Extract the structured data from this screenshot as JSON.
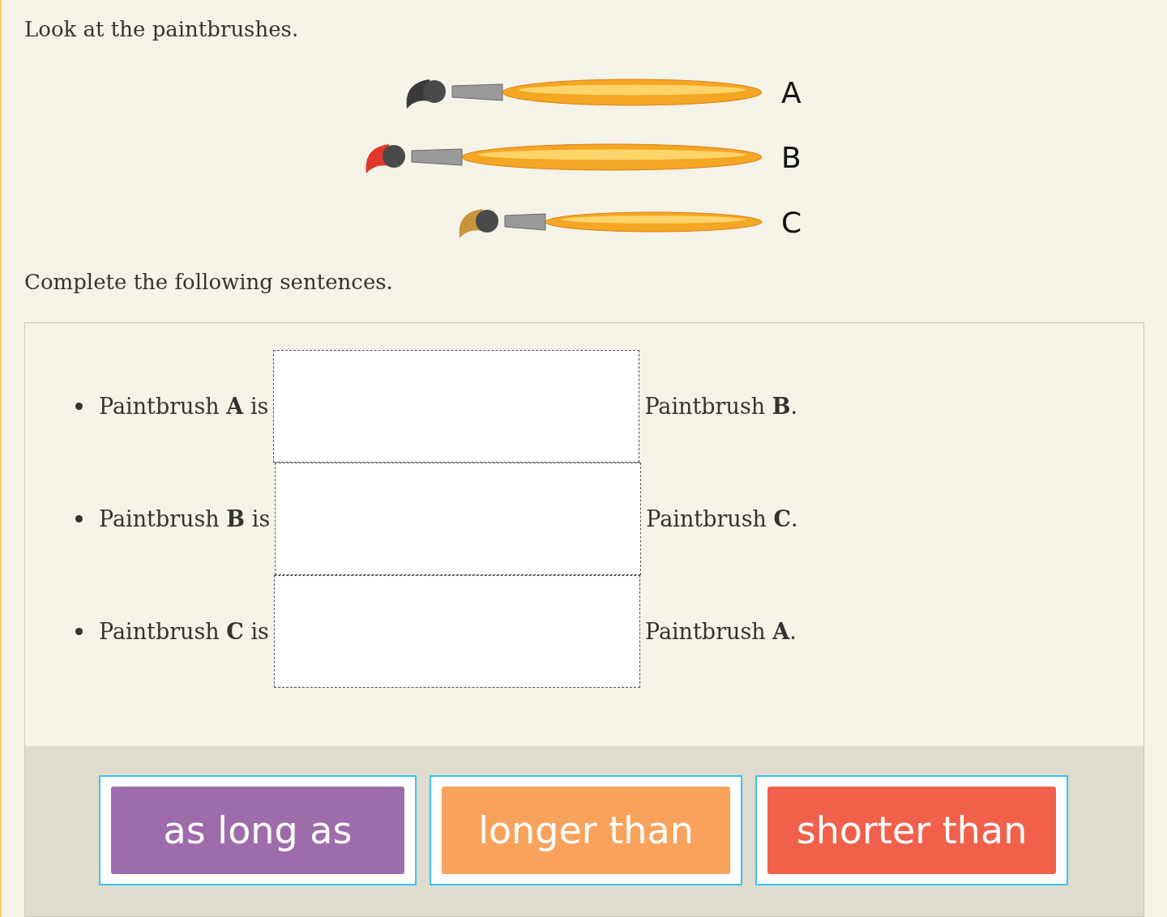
{
  "instruction": "Look at the paintbrushes.",
  "brushes": [
    {
      "label": "A",
      "color": "#3a3a3a"
    },
    {
      "label": "B",
      "color": "#e0382a"
    },
    {
      "label": "C",
      "color": "#c8963a"
    }
  ],
  "prompt": "Complete the following sentences.",
  "sentences": [
    {
      "before": "Paintbrush **A** is",
      "after": "Paintbrush **B**."
    },
    {
      "before": "Paintbrush **B** is",
      "after": "Paintbrush **C**."
    },
    {
      "before": "Paintbrush **C** is",
      "after": "Paintbrush **A**."
    }
  ],
  "choices": [
    {
      "label": "as long as",
      "color": "#9e6bab"
    },
    {
      "label": "longer than",
      "color": "#f8a25c"
    },
    {
      "label": "shorter than",
      "color": "#f0604a"
    }
  ]
}
